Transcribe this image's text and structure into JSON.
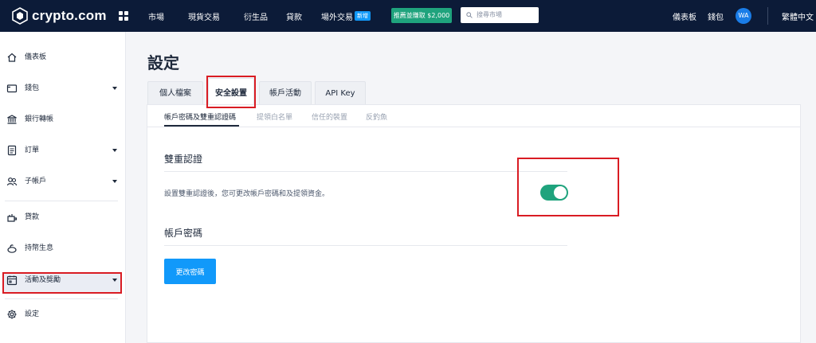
{
  "header": {
    "brand": "crypto.com",
    "nav": [
      "市場",
      "現貨交易",
      "衍生品",
      "貸款",
      "場外交易"
    ],
    "new_badge": "新增",
    "promo": "推薦並賺取 $2,000",
    "search_placeholder": "搜尋市場",
    "dashboard": "儀表板",
    "wallet": "錢包",
    "avatar": "WA",
    "language": "繁體中文"
  },
  "sidebar": {
    "items": [
      {
        "label": "儀表板",
        "icon": "home-icon"
      },
      {
        "label": "錢包",
        "icon": "wallet-icon"
      },
      {
        "label": "銀行轉帳",
        "icon": "bank-icon"
      },
      {
        "label": "訂單",
        "icon": "orders-icon"
      },
      {
        "label": "子帳戶",
        "icon": "sub-account-icon"
      },
      {
        "label": "貸款",
        "icon": "loan-icon"
      },
      {
        "label": "持幣生息",
        "icon": "earn-icon"
      },
      {
        "label": "活動及獎勵",
        "icon": "calendar-icon"
      },
      {
        "label": "設定",
        "icon": "gear-icon"
      }
    ]
  },
  "main": {
    "title": "設定",
    "tabs": [
      "個人檔案",
      "安全設置",
      "帳戶活動",
      "API Key"
    ],
    "active_tab": "安全設置",
    "subtabs": [
      "帳戶密碼及雙重認證碼",
      "提領白名單",
      "信任的裝置",
      "反釣魚"
    ],
    "two_factor": {
      "title": "雙重認證",
      "description": "設置雙重認證後，您可更改帳戶密碼和及提領資金。",
      "enabled": true
    },
    "password": {
      "title": "帳戶密碼",
      "button": "更改密碼"
    }
  },
  "colors": {
    "topbar": "#0c1b38",
    "accent_blue": "#1199fa",
    "toggle_green": "#1fa37d",
    "highlight_red": "#d91c23"
  }
}
